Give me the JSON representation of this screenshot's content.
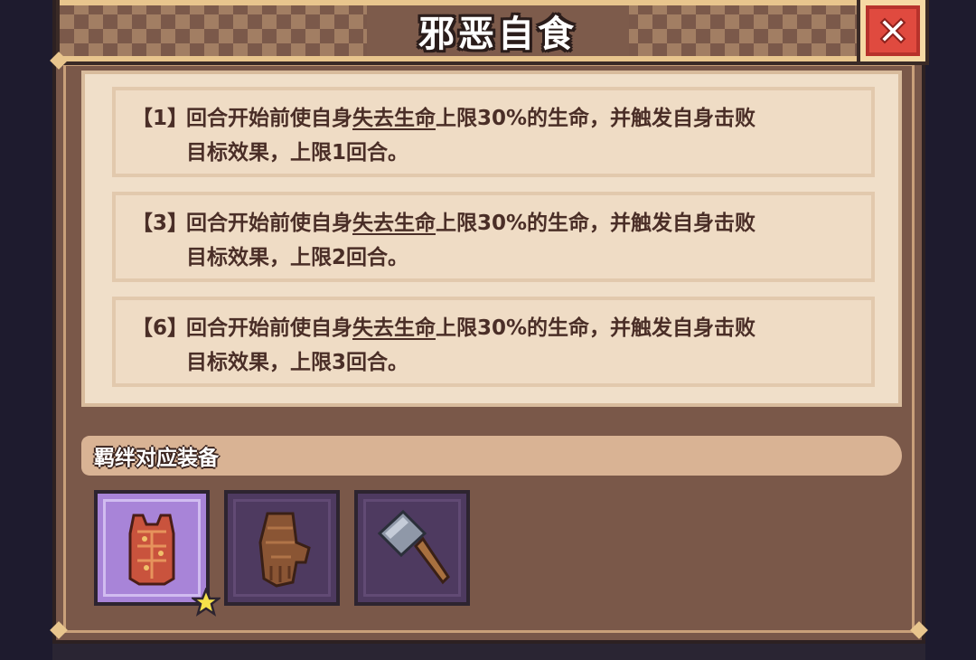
{
  "dialog": {
    "title": "邪恶自食"
  },
  "tiers": [
    {
      "tag": "【1】",
      "pre": "回合开始前使自身",
      "link": "失去生命",
      "post": "上限30%的生命，并触发自身击败",
      "line2": "目标效果，上限1回合。"
    },
    {
      "tag": "【3】",
      "pre": "回合开始前使自身",
      "link": "失去生命",
      "post": "上限30%的生命，并触发自身击败",
      "line2": "目标效果，上限2回合。"
    },
    {
      "tag": "【6】",
      "pre": "回合开始前使自身",
      "link": "失去生命",
      "post": "上限30%的生命，并触发自身击败",
      "line2": "目标效果，上限3回合。"
    }
  ],
  "equipment": {
    "header": "羁绊对应装备",
    "items": [
      {
        "icon": "flesh-vest-icon",
        "state": "selected",
        "starred": true
      },
      {
        "icon": "leather-glove-icon",
        "state": "normal",
        "starred": false
      },
      {
        "icon": "cleaver-icon",
        "state": "normal",
        "starred": false
      }
    ]
  },
  "colors": {
    "frame": "#79584a",
    "panel": "#f0dfc9",
    "text": "#4a2e27",
    "close": "#e04a3f",
    "selected_slot": "#a884d8"
  }
}
